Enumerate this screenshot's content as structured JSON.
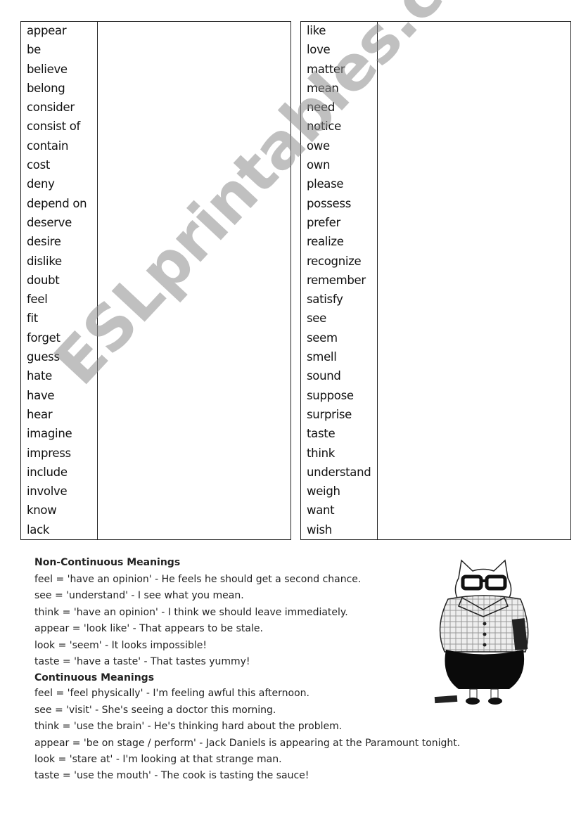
{
  "watermark": "ESLprintables.com",
  "tables": {
    "left": [
      "appear",
      "be",
      "believe",
      "belong",
      "consider",
      "consist of",
      "contain",
      "cost",
      "deny",
      "depend on",
      "deserve",
      "desire",
      "dislike",
      "doubt",
      "feel",
      "fit",
      "forget",
      "guess",
      "hate",
      "have",
      "hear",
      "imagine",
      "impress",
      "include",
      "involve",
      "know",
      "lack"
    ],
    "right": [
      "like",
      "love",
      "matter",
      "mean",
      "need",
      "notice",
      "owe",
      "own",
      "please",
      "possess",
      "prefer",
      "realize",
      "recognize",
      "remember",
      "satisfy",
      "see",
      "seem",
      "smell",
      "sound",
      "suppose",
      "surprise",
      "taste",
      "think",
      "understand",
      "weigh",
      "want",
      "wish"
    ]
  },
  "non_continuous": {
    "heading": "Non-Continuous Meanings",
    "lines": [
      "feel = 'have an opinion' - He feels he should get a second chance.",
      "see = 'understand' - I see what you mean.",
      "think = 'have an opinion' - I think we should leave immediately.",
      "appear = 'look like' - That appears to be stale.",
      "look = 'seem' - It looks impossible!",
      "taste = 'have a taste' - That tastes yummy!"
    ]
  },
  "continuous": {
    "heading": "Continuous Meanings",
    "lines": [
      "feel = 'feel physically' - I'm feeling awful this afternoon.",
      "see = 'visit' - She's seeing a doctor this morning.",
      "think = 'use the brain' - He's thinking hard about the problem.",
      "appear = 'be on stage / perform' - Jack Daniels is appearing at the Paramount tonight.",
      "look = 'stare at' - I'm looking at that strange man.",
      "taste = 'use the mouth' - The cook is tasting the sauce!"
    ]
  }
}
